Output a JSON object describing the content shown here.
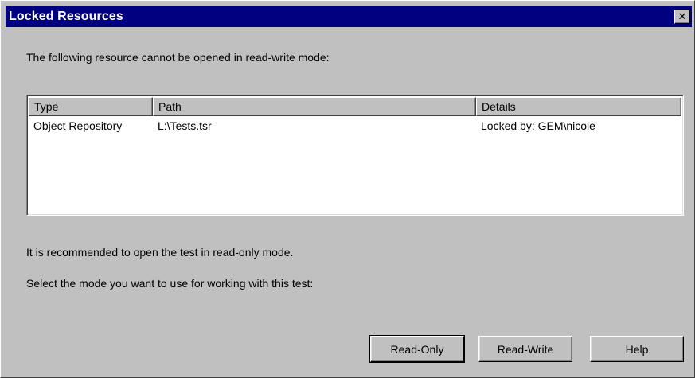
{
  "dialog": {
    "title": "Locked Resources",
    "close_glyph": "✕",
    "message": "The following resource cannot be opened in read-write mode:",
    "table": {
      "columns": [
        "Type",
        "Path",
        "Details"
      ],
      "rows": [
        [
          "Object Repository",
          "L:\\Tests.tsr",
          "Locked by: GEM\\nicole"
        ]
      ]
    },
    "recommendation": "It is recommended to open the test in read-only mode.",
    "select_prompt": "Select the mode you want to use for working with this test:",
    "buttons": {
      "read_only": "Read-Only",
      "read_write": "Read-Write",
      "help": "Help"
    }
  },
  "colors": {
    "titlebar": "#000080",
    "face": "#c0c0c0",
    "list_bg": "#ffffff"
  },
  "icons": {
    "close": "close-icon"
  }
}
